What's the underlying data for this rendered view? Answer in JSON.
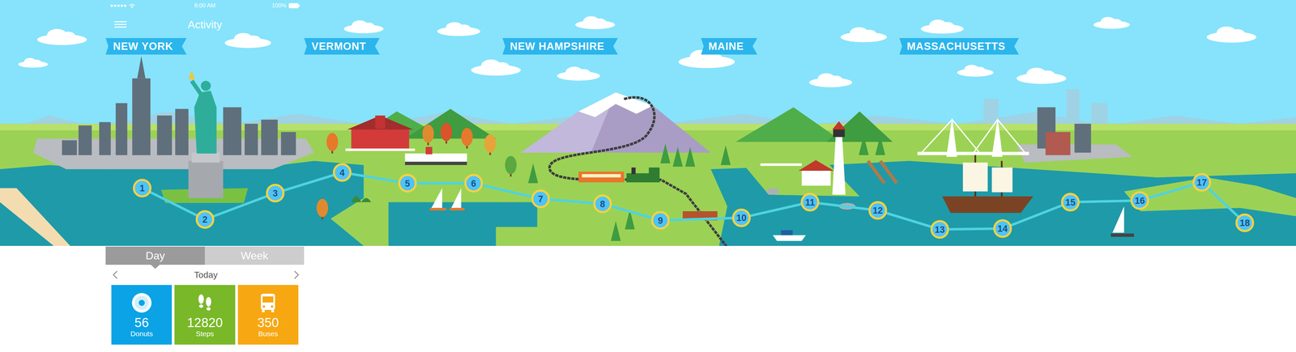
{
  "status_bar": {
    "time": "8:00 AM",
    "battery": "100%"
  },
  "header": {
    "title": "Activity"
  },
  "regions": [
    {
      "label": "NEW YORK"
    },
    {
      "label": "VERMONT"
    },
    {
      "label": "NEW HAMPSHIRE"
    },
    {
      "label": "MAINE"
    },
    {
      "label": "MASSACHUSETTS"
    }
  ],
  "route": {
    "stops": [
      {
        "label": "1"
      },
      {
        "label": "2"
      },
      {
        "label": "3"
      },
      {
        "label": "4"
      },
      {
        "label": "5"
      },
      {
        "label": "6"
      },
      {
        "label": "7"
      },
      {
        "label": "8"
      },
      {
        "label": "9"
      },
      {
        "label": "10"
      },
      {
        "label": "11"
      },
      {
        "label": "12"
      },
      {
        "label": "13"
      },
      {
        "label": "14"
      },
      {
        "label": "15"
      },
      {
        "label": "16"
      },
      {
        "label": "17"
      },
      {
        "label": "18"
      }
    ]
  },
  "tabs": [
    {
      "label": "Day",
      "selected": true
    },
    {
      "label": "Week",
      "selected": false
    }
  ],
  "date_nav": {
    "label": "Today"
  },
  "stats": [
    {
      "kind": "donut",
      "value": "56",
      "label": "Donuts",
      "color": "#0ba3e6"
    },
    {
      "kind": "steps",
      "value": "12820",
      "label": "Steps",
      "color": "#79b829"
    },
    {
      "kind": "bus",
      "value": "350",
      "label": "Buses",
      "color": "#f7a712"
    }
  ]
}
